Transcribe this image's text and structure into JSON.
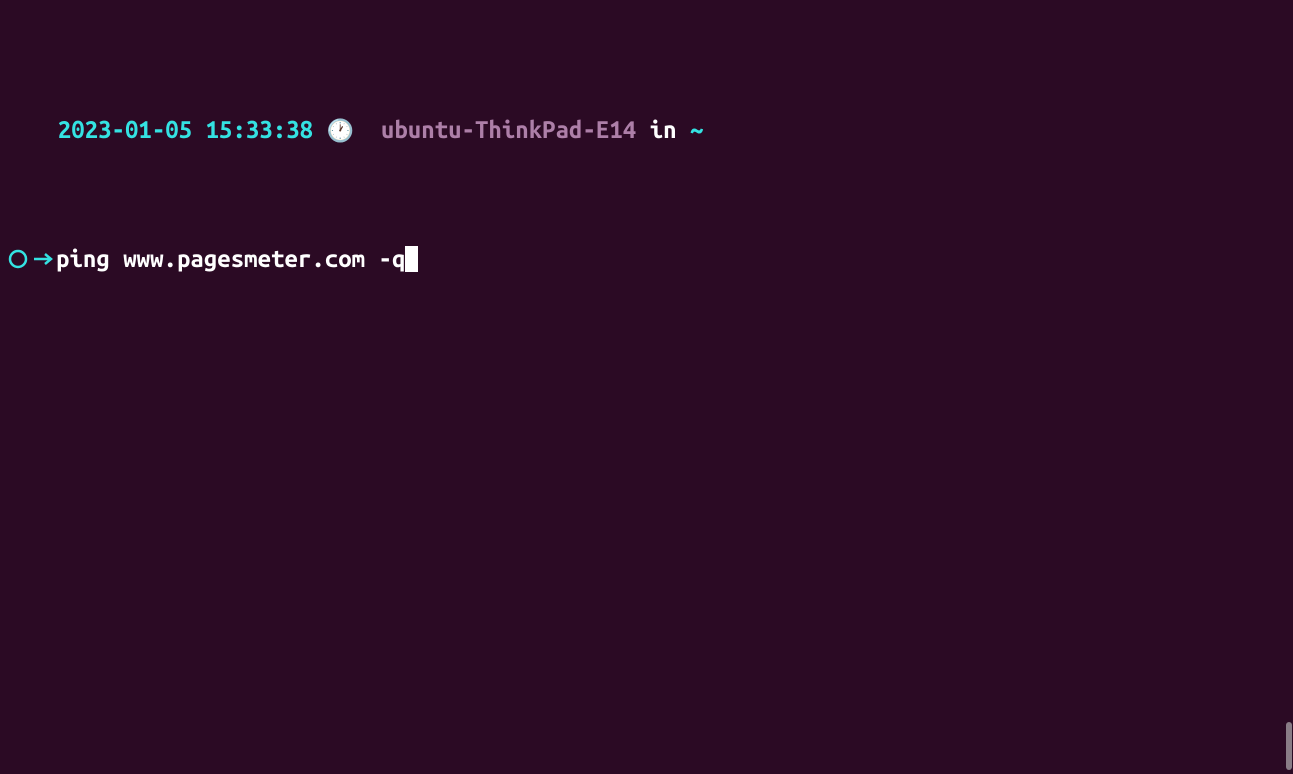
{
  "prompt": {
    "timestamp": "2023-01-05 15:33:38",
    "clock_glyph": "🕐",
    "hostname": "ubuntu-ThinkPad-E14",
    "in_word": "in",
    "cwd": "~",
    "circle_color": "#34e2e2",
    "arrow_color": "#34e2e2"
  },
  "command": {
    "text": "ping www.pagesmeter.com -q"
  },
  "colors": {
    "background": "#2b0a24",
    "cyan": "#34e2e2",
    "purple": "#ad7fa8",
    "white": "#ffffff"
  }
}
